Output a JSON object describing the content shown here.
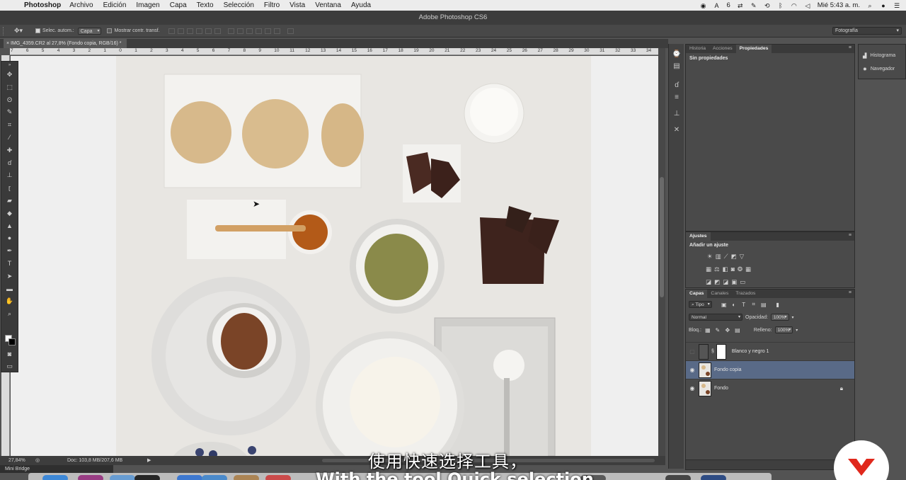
{
  "menubar": {
    "app_name": "Photoshop",
    "items": [
      "Archivo",
      "Edición",
      "Imagen",
      "Capa",
      "Texto",
      "Selección",
      "Filtro",
      "Vista",
      "Ventana",
      "Ayuda"
    ],
    "badge_count": "6",
    "clock": "Mié 5:43 a. m."
  },
  "window": {
    "title": "Adobe Photoshop CS6"
  },
  "options_bar": {
    "auto_select_label": "Selec. autom.:",
    "auto_select_value": "Capa",
    "transform_label": "Mostrar contr. transf.",
    "workspace": "Fotografía"
  },
  "document": {
    "tab_label": "IMG_4359.CR2 al 27,8% (Fondo copia, RGB/16) *"
  },
  "ruler": {
    "marks": [
      "7",
      "6",
      "5",
      "4",
      "3",
      "2",
      "1",
      "0",
      "1",
      "2",
      "3",
      "4",
      "5",
      "6",
      "7",
      "8",
      "9",
      "10",
      "11",
      "12",
      "13",
      "14",
      "15",
      "16",
      "17",
      "18",
      "19",
      "20",
      "21",
      "22",
      "23",
      "24",
      "25",
      "26",
      "27",
      "28",
      "29",
      "30",
      "31",
      "32",
      "33",
      "34"
    ]
  },
  "status": {
    "zoom": "27,84%",
    "doc_info": "Doc: 103,8 MB/207,6 MB"
  },
  "mini_bridge": "Mini Bridge",
  "panels": {
    "top_tabs": [
      "Historia",
      "Acciones",
      "Propiedades"
    ],
    "properties_empty": "Sin propiedades",
    "adjustments_tab": "Ajustes",
    "adjustments_label": "Añadir un ajuste",
    "layers_tabs": [
      "Capas",
      "Canales",
      "Trazados"
    ],
    "filter_kind": "Tipo",
    "blend_mode": "Normal",
    "opacity_label": "Opacidad:",
    "opacity_value": "100%",
    "lock_label": "Bloq.:",
    "fill_label": "Relleno:",
    "fill_value": "100%",
    "layers": [
      {
        "name": "Blanco y negro 1",
        "visible": false,
        "selected": false,
        "locked": false
      },
      {
        "name": "Fondo copia",
        "visible": true,
        "selected": true,
        "locked": false
      },
      {
        "name": "Fondo",
        "visible": true,
        "selected": false,
        "locked": true
      }
    ],
    "collapsed": [
      "Histograma",
      "Navegador"
    ]
  },
  "subtitles": {
    "chinese": "使用快速选择工具，",
    "english": "With the tool Quick selection"
  },
  "colors": {
    "accent_layer_selected": "#596a87",
    "logo_red": "#e0281c"
  }
}
